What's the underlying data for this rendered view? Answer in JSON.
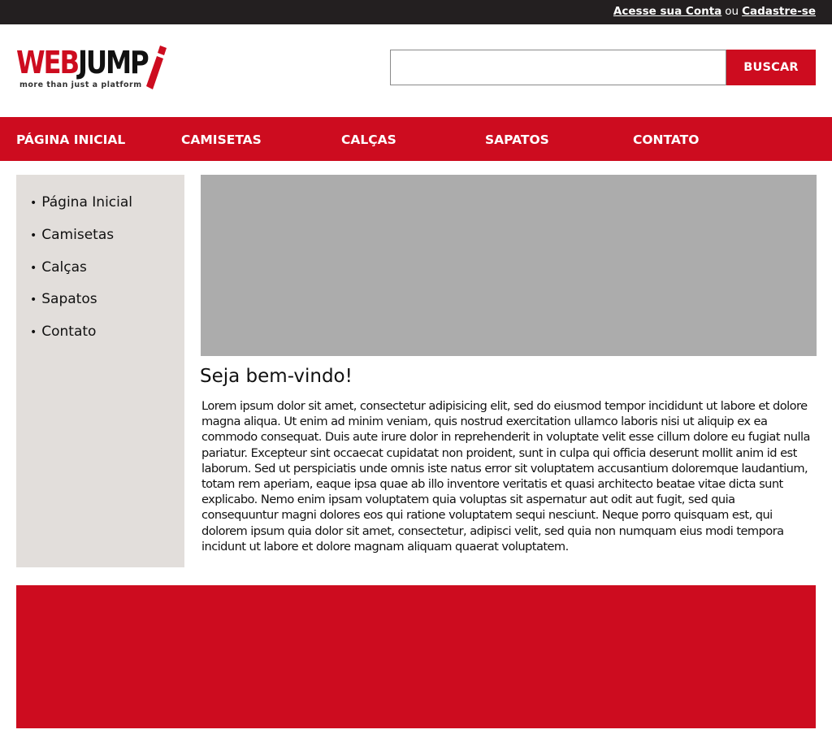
{
  "topbar": {
    "account_link": "Acesse sua Conta",
    "separator": "ou",
    "signup_link": "Cadastre-se"
  },
  "logo": {
    "text_red": "WEB",
    "text_black": "JUMP",
    "tagline": "more than just a platform"
  },
  "search": {
    "value": "",
    "placeholder": "",
    "button_label": "BUSCAR"
  },
  "nav": {
    "items": [
      {
        "label": "PÁGINA INICIAL"
      },
      {
        "label": "CAMISETAS"
      },
      {
        "label": "CALÇAS"
      },
      {
        "label": "SAPATOS"
      },
      {
        "label": "CONTATO"
      }
    ]
  },
  "sidebar": {
    "bullet": "•",
    "items": [
      {
        "label": "Página Inicial"
      },
      {
        "label": "Camisetas"
      },
      {
        "label": "Calças"
      },
      {
        "label": "Sapatos"
      },
      {
        "label": "Contato"
      }
    ]
  },
  "main": {
    "title": "Seja bem-vindo!",
    "body": "Lorem ipsum dolor sit amet, consectetur adipisicing elit, sed do eiusmod tempor incididunt ut labore et dolore magna aliqua. Ut enim ad minim veniam, quis nostrud exercitation ullamco laboris nisi ut aliquip ex ea commodo consequat. Duis aute irure dolor in reprehenderit in voluptate velit esse cillum dolore eu fugiat nulla pariatur. Excepteur sint occaecat cupidatat non proident, sunt in culpa qui officia deserunt mollit anim id est laborum. Sed ut perspiciatis unde omnis iste natus error sit voluptatem accusantium doloremque laudantium, totam rem aperiam, eaque ipsa quae ab illo inventore veritatis et quasi architecto beatae vitae dicta sunt explicabo. Nemo enim ipsam voluptatem quia voluptas sit aspernatur aut odit aut fugit, sed quia consequuntur magni dolores eos qui ratione voluptatem sequi nesciunt. Neque porro quisquam est, qui dolorem ipsum quia dolor sit amet, consectetur, adipisci velit, sed quia non numquam eius modi tempora incidunt ut labore et dolore magnam aliquam quaerat voluptatem."
  },
  "colors": {
    "brand_red": "#cd0c1f",
    "topbar_bg": "#231f20",
    "sidebar_bg": "#e2dedb",
    "banner_placeholder": "#acacac"
  }
}
